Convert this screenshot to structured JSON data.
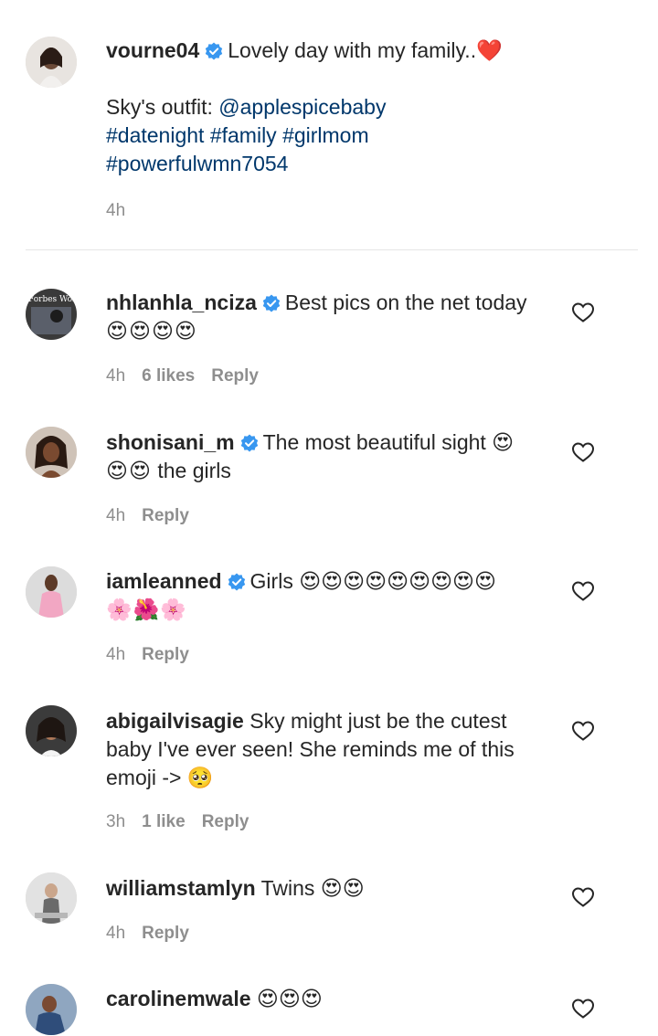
{
  "caption": {
    "username": "vourne04",
    "verified": true,
    "text": "Lovely day with my family..",
    "heart_emoji": "❤️",
    "outfit_label": "Sky's outfit: ",
    "mention": "@applespicebaby",
    "hashtags_line1": "#datenight #family #girlmom",
    "hashtags_line2": "#powerfulwmn7054",
    "time": "4h"
  },
  "comments": [
    {
      "username": "nhlanhla_nciza",
      "verified": true,
      "text": "Best pics on the net today",
      "emoji_line": "😍😍😍😍",
      "time": "4h",
      "likes": "6 likes",
      "reply": "Reply",
      "avatar_text": "Forbes Woman"
    },
    {
      "username": "shonisani_m",
      "verified": true,
      "text": "The most beautiful sight 😍",
      "emoji_line": "😍😍",
      "text2": " the girls",
      "time": "4h",
      "reply": "Reply"
    },
    {
      "username": "iamleanned",
      "verified": true,
      "text": "Girls 😍😍😍😍😍😍😍😍😍",
      "emoji_line": "🌸🌺🌸",
      "time": "4h",
      "reply": "Reply"
    },
    {
      "username": "abigailvisagie",
      "verified": false,
      "text": "Sky might just be the cutest baby I've ever seen! She reminds me of this emoji -> 🥺",
      "time": "3h",
      "likes": "1 like",
      "reply": "Reply"
    },
    {
      "username": "williamstamlyn",
      "verified": false,
      "text": "Twins 😍😍",
      "time": "4h",
      "reply": "Reply"
    },
    {
      "username": "carolinemwale",
      "verified": false,
      "text": "😍😍😍",
      "time": "",
      "reply": ""
    }
  ],
  "colors": {
    "link": "#00376b",
    "meta": "#8e8e8e",
    "verified": "#3897f0",
    "text": "#262626"
  },
  "icons": {
    "verified": "verified-badge-icon",
    "like": "heart-outline-icon"
  }
}
